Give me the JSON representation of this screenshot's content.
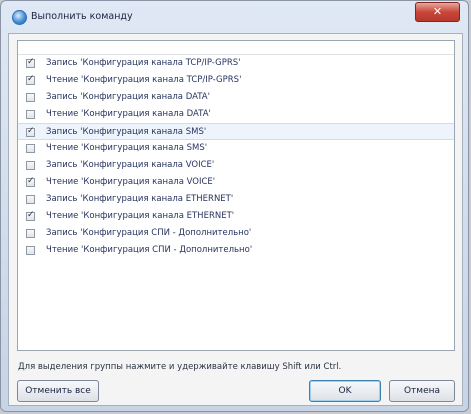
{
  "window": {
    "title": "Выполнить команду",
    "close_label": "✕"
  },
  "items": [
    {
      "label": "Запись 'Конфигурация канала TCP/IP-GPRS'",
      "checked": true
    },
    {
      "label": "Чтение 'Конфигурация канала TCP/IP-GPRS'",
      "checked": true
    },
    {
      "label": "Запись 'Конфигурация канала DATA'",
      "checked": false
    },
    {
      "label": "Чтение 'Конфигурация канала DATA'",
      "checked": false
    },
    {
      "label": "Запись 'Конфигурация канала SMS'",
      "checked": true,
      "selected": true
    },
    {
      "label": "Чтение 'Конфигурация канала SMS'",
      "checked": false
    },
    {
      "label": "Запись 'Конфигурация канала VOICE'",
      "checked": false
    },
    {
      "label": "Чтение 'Конфигурация канала VOICE'",
      "checked": true
    },
    {
      "label": "Запись 'Конфигурация канала ETHERNET'",
      "checked": false
    },
    {
      "label": "Чтение 'Конфигурация канала ETHERNET'",
      "checked": true
    },
    {
      "label": "Запись 'Конфигурация СПИ - Дополнительно'",
      "checked": false
    },
    {
      "label": "Чтение 'Конфигурация СПИ - Дополнительно'",
      "checked": false
    }
  ],
  "hint": "Для выделения группы нажмите и удерживайте клавишу Shift или Ctrl.",
  "buttons": {
    "deselect_all": "Отменить все",
    "ok": "OK",
    "cancel": "Отмена"
  }
}
